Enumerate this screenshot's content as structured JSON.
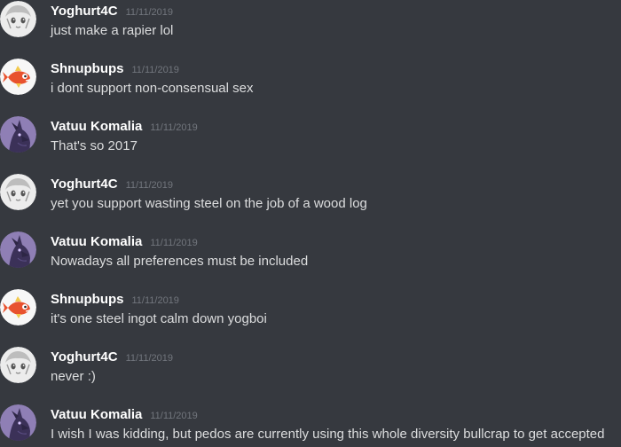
{
  "messages": [
    {
      "author": "Yoghurt4C",
      "timestamp": "11/11/2019",
      "text": "just make a rapier lol",
      "avatar": "anime-avatar-icon"
    },
    {
      "author": "Shnupbups",
      "timestamp": "11/11/2019",
      "text": "i dont support non-consensual sex",
      "avatar": "fish-avatar-icon"
    },
    {
      "author": "Vatuu Komalia",
      "timestamp": "11/11/2019",
      "text": "That's so 2017",
      "avatar": "dragon-avatar-icon"
    },
    {
      "author": "Yoghurt4C",
      "timestamp": "11/11/2019",
      "text": "yet you support wasting steel on the job of a wood log",
      "avatar": "anime-avatar-icon"
    },
    {
      "author": "Vatuu Komalia",
      "timestamp": "11/11/2019",
      "text": "Nowadays all preferences must be included",
      "avatar": "dragon-avatar-icon"
    },
    {
      "author": "Shnupbups",
      "timestamp": "11/11/2019",
      "text": "it's one steel ingot calm down yogboi",
      "avatar": "fish-avatar-icon"
    },
    {
      "author": "Yoghurt4C",
      "timestamp": "11/11/2019",
      "text": "never :)",
      "avatar": "anime-avatar-icon"
    },
    {
      "author": "Vatuu Komalia",
      "timestamp": "11/11/2019",
      "text": "I wish I was kidding, but pedos are currently using this whole diversity bullcrap to get accepted",
      "avatar": "dragon-avatar-icon"
    }
  ],
  "colors": {
    "background": "#36393f",
    "username": "#ffffff",
    "timestamp": "#72767d",
    "message_text": "#dcddde"
  }
}
